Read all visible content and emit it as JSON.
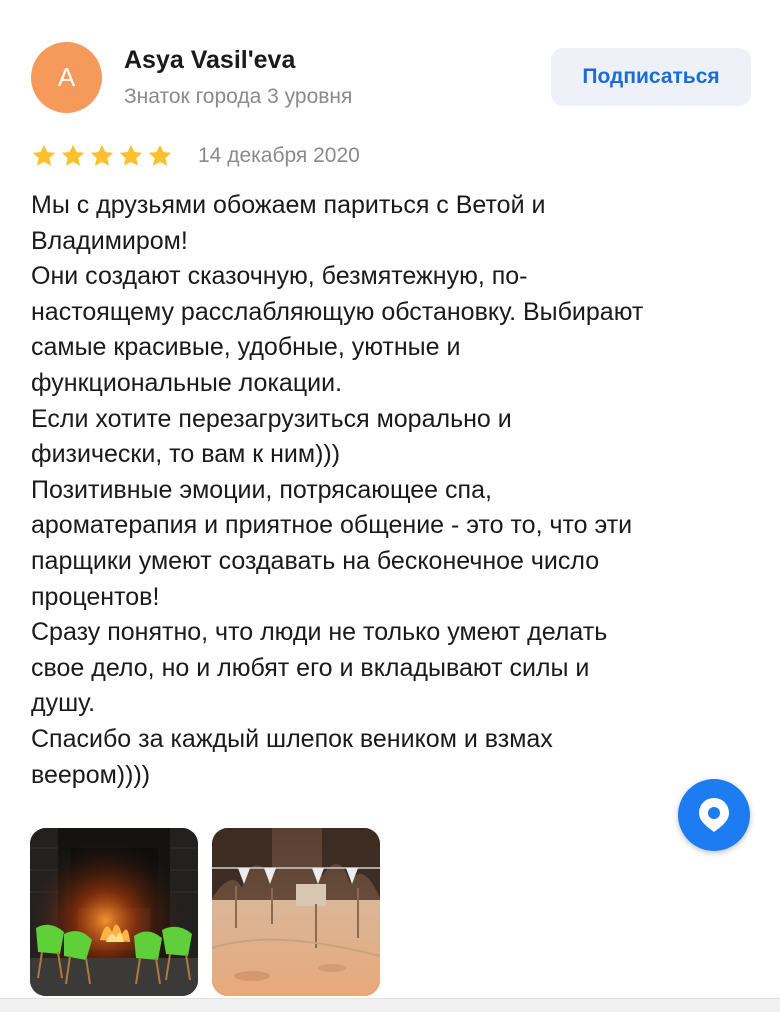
{
  "author": {
    "avatar_letter": "A",
    "name": "Asya Vasil'eva",
    "level": "Знаток города 3 уровня"
  },
  "subscribe": {
    "label": "Подписаться"
  },
  "review": {
    "rating": 5,
    "rating_max": 5,
    "date": "14 декабря 2020",
    "lines": [
      "Мы с друзьями обожаем париться с Ветой и",
      "Владимиром!",
      "Они создают сказочную, безмятежную, по-",
      "настоящему расслабляющую обстановку. Выбирают",
      "самые красивые, удобные, уютные и",
      "функциональные локации.",
      "Если хотите перезагрузиться морально и",
      "физически, то вам к ним)))",
      "Позитивные эмоции, потрясающее спа,",
      "ароматерапия и приятное общение - это то, что эти",
      "парщики умеют создавать на бесконечное число",
      "процентов!",
      "Сразу понятно, что люди не только умеют делать",
      "свое дело, но и любят его и вкладывают силы и",
      "душу.",
      "Спасибо за каждый шлепок веником и взмах",
      "веером))))"
    ]
  },
  "photos": [
    {
      "icon": "fireplace-chairs-photo"
    },
    {
      "icon": "snowy-yard-photo"
    }
  ],
  "map_button": {
    "icon": "map-pin-icon"
  },
  "colors": {
    "avatar": "#f59a5b",
    "star": "#fbc02d",
    "accent": "#1a6dd6",
    "fab": "#1d7cf2"
  }
}
